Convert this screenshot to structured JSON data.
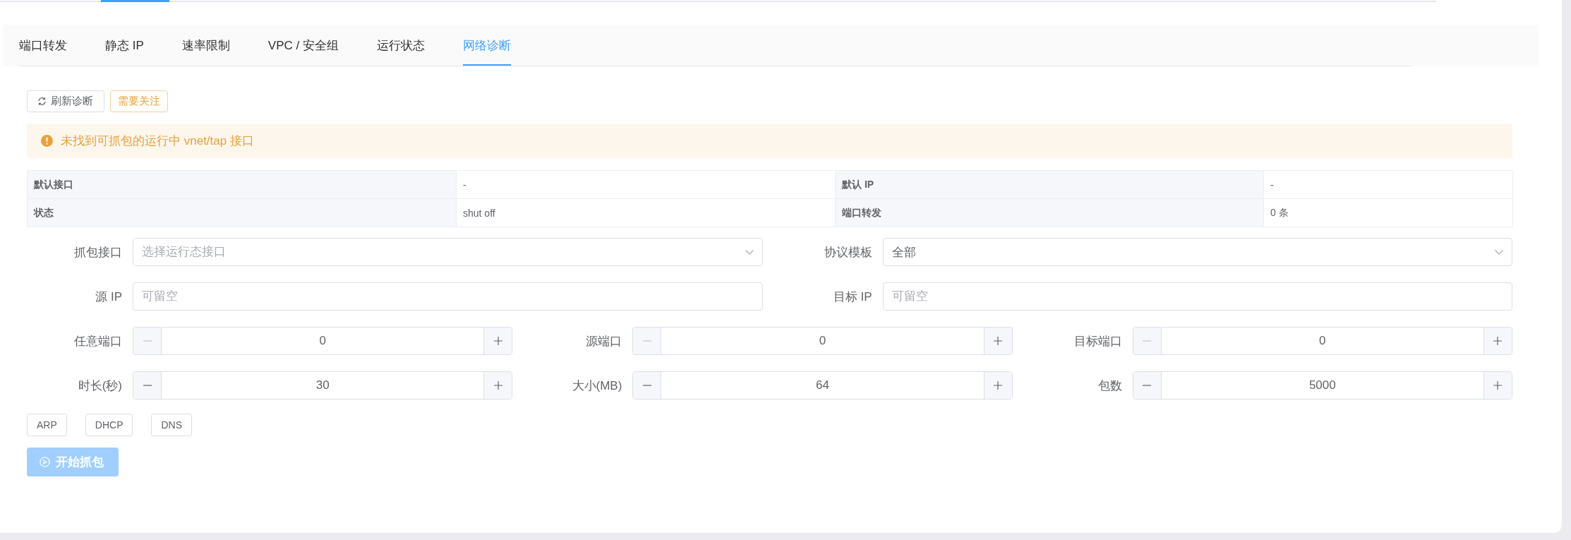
{
  "tabs": [
    {
      "label": "端口转发",
      "selected": false
    },
    {
      "label": "静态 IP",
      "selected": false
    },
    {
      "label": "速率限制",
      "selected": false
    },
    {
      "label": "VPC / 安全组",
      "selected": false
    },
    {
      "label": "运行状态",
      "selected": false
    },
    {
      "label": "网络诊断",
      "selected": true
    }
  ],
  "toolbar": {
    "refresh_button": "刷新诊断",
    "status_tag": "需要关注"
  },
  "alert": {
    "message": "未找到可抓包的运行中 vnet/tap 接口"
  },
  "summary": {
    "rows": [
      [
        {
          "label": "默认接口",
          "value": "-"
        },
        {
          "label": "默认 IP",
          "value": "-"
        }
      ],
      [
        {
          "label": "状态",
          "value": "shut off"
        },
        {
          "label": "端口转发",
          "value": "0 条"
        }
      ]
    ]
  },
  "form": {
    "rows": [
      [
        {
          "kind": "select",
          "label": "抓包接口",
          "placeholder": "选择运行态接口"
        },
        {
          "kind": "select",
          "label": "协议模板",
          "value": "全部"
        }
      ],
      [
        {
          "kind": "text",
          "label": "源 IP",
          "placeholder": "可留空"
        },
        {
          "kind": "text",
          "label": "目标 IP",
          "placeholder": "可留空"
        }
      ],
      [
        {
          "kind": "number",
          "label": "任意端口",
          "value": "0",
          "decrement_disabled": true
        },
        {
          "kind": "number",
          "label": "源端口",
          "value": "0",
          "decrement_disabled": true
        },
        {
          "kind": "number",
          "label": "目标端口",
          "value": "0",
          "decrement_disabled": true
        }
      ],
      [
        {
          "kind": "number",
          "label": "时长(秒)",
          "value": "30",
          "decrement_disabled": false
        },
        {
          "kind": "number",
          "label": "大小(MB)",
          "value": "64",
          "decrement_disabled": false
        },
        {
          "kind": "number",
          "label": "包数",
          "value": "5000",
          "decrement_disabled": false
        }
      ]
    ]
  },
  "presets": [
    {
      "label": "ARP"
    },
    {
      "label": "DHCP"
    },
    {
      "label": "DNS"
    }
  ],
  "start_button": {
    "label": "开始抓包",
    "disabled": true
  }
}
